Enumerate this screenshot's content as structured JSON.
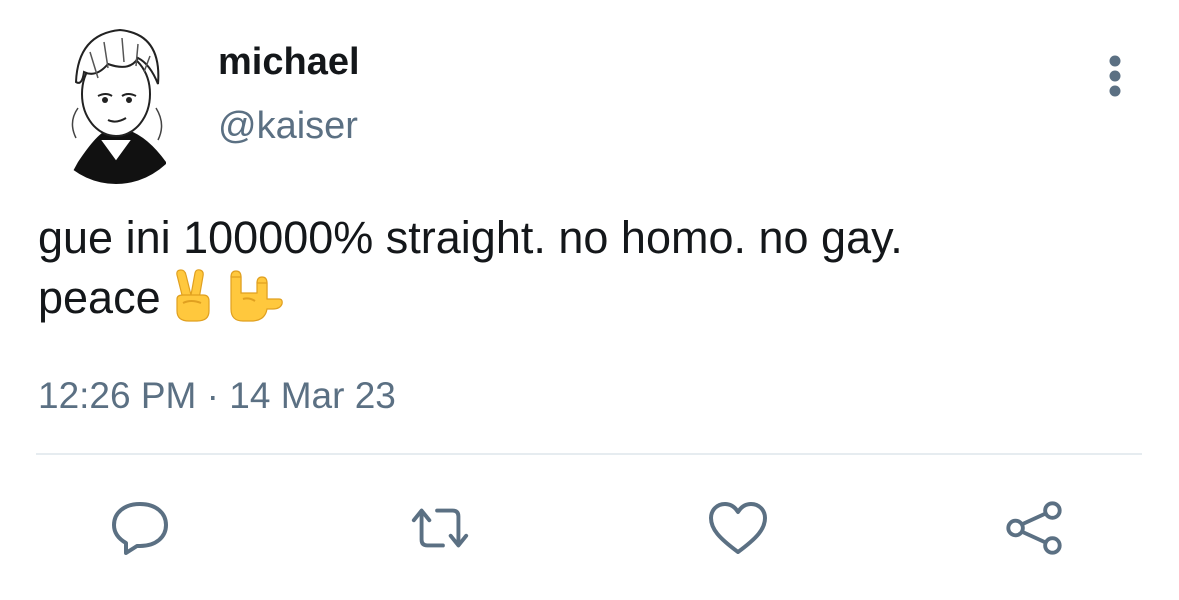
{
  "author": {
    "display_name": "michael",
    "handle": "@kaiser",
    "avatar_icon": "anime-character-avatar"
  },
  "tweet": {
    "text": "gue ini 100000% straight. no homo. no gay.\npeace",
    "emojis": [
      "victory-hand",
      "love-you-gesture"
    ],
    "time": "12:26 PM",
    "separator": "·",
    "date": "14 Mar 23"
  },
  "actions": [
    {
      "name": "reply",
      "icon": "speech-bubble-icon"
    },
    {
      "name": "retweet",
      "icon": "retweet-arrows-icon"
    },
    {
      "name": "like",
      "icon": "heart-icon"
    },
    {
      "name": "share",
      "icon": "share-nodes-icon"
    }
  ],
  "colors": {
    "text_primary": "#14171a",
    "text_secondary": "#5b7083",
    "icon": "#5b7083",
    "divider": "#e6ecf0",
    "emoji": "#ffc83d"
  }
}
